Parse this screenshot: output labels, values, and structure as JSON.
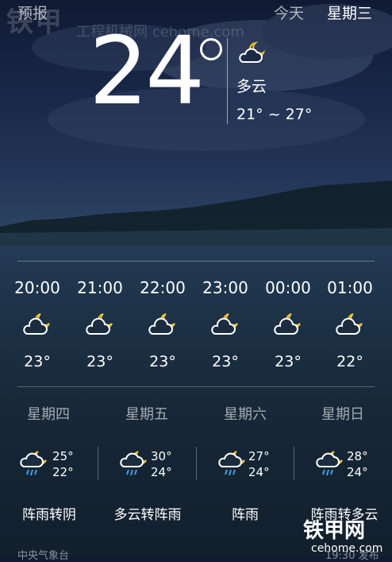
{
  "watermark": {
    "text": "铁甲",
    "sub": "工程机械网 cehome.com"
  },
  "current": {
    "temp": "24",
    "condition": "多云",
    "range": "21° ~ 27°",
    "icon": "partly-cloudy-night-icon"
  },
  "forecast": {
    "label": "预报",
    "today": "今天",
    "day": "星期三"
  },
  "hourly": [
    {
      "time": "20:00",
      "temp": "23°",
      "icon": "partly-cloudy-night-icon"
    },
    {
      "time": "21:00",
      "temp": "23°",
      "icon": "partly-cloudy-night-icon"
    },
    {
      "time": "22:00",
      "temp": "23°",
      "icon": "partly-cloudy-night-icon"
    },
    {
      "time": "23:00",
      "temp": "23°",
      "icon": "partly-cloudy-night-icon"
    },
    {
      "time": "00:00",
      "temp": "23°",
      "icon": "partly-cloudy-night-icon"
    },
    {
      "time": "01:00",
      "temp": "22°",
      "icon": "partly-cloudy-night-icon"
    }
  ],
  "daily": [
    {
      "day": "星期四",
      "hi": "25°",
      "lo": "22°",
      "cond": "阵雨转阴",
      "icon": "rain-night-icon"
    },
    {
      "day": "星期五",
      "hi": "30°",
      "lo": "24°",
      "cond": "多云转阵雨",
      "icon": "rain-night-icon"
    },
    {
      "day": "星期六",
      "hi": "27°",
      "lo": "24°",
      "cond": "阵雨",
      "icon": "rain-night-icon"
    },
    {
      "day": "星期日",
      "hi": "28°",
      "lo": "24°",
      "cond": "阵雨转多云",
      "icon": "rain-night-icon"
    }
  ],
  "footer": {
    "source": "中央气象台",
    "time": "19:30 发布"
  },
  "logo": {
    "text": "铁甲网",
    "sub": "cehome.com"
  }
}
